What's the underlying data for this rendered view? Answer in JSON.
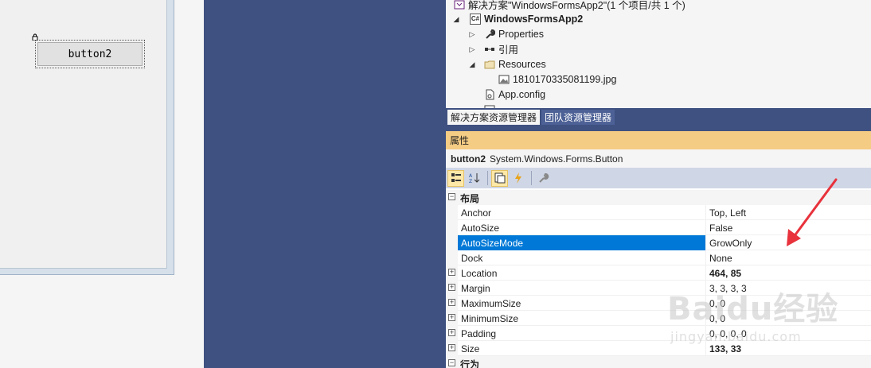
{
  "designer": {
    "button_label": "button2"
  },
  "solution_explorer": {
    "solution_label": "解决方案\"WindowsFormsApp2\"(1 个项目/共 1 个)",
    "project_label": "WindowsFormsApp2",
    "project_badge": "C#",
    "items": [
      {
        "label": "Properties",
        "icon": "wrench-icon"
      },
      {
        "label": "引用",
        "icon": "references-icon"
      },
      {
        "label": "Resources",
        "icon": "folder-icon"
      },
      {
        "label": "1810170335081199.jpg",
        "icon": "image-file-icon"
      },
      {
        "label": "App.config",
        "icon": "config-file-icon"
      }
    ],
    "tabs": [
      "解决方案资源管理器",
      "团队资源管理器"
    ]
  },
  "properties": {
    "title": "属性",
    "object_name": "button2",
    "object_type": "System.Windows.Forms.Button",
    "category_layout": "布局",
    "category_behavior": "行为",
    "rows": [
      {
        "name": "Anchor",
        "value": "Top, Left"
      },
      {
        "name": "AutoSize",
        "value": "False"
      },
      {
        "name": "AutoSizeMode",
        "value": "GrowOnly"
      },
      {
        "name": "Dock",
        "value": "None"
      },
      {
        "name": "Location",
        "value": "464, 85"
      },
      {
        "name": "Margin",
        "value": "3, 3, 3, 3"
      },
      {
        "name": "MaximumSize",
        "value": "0, 0"
      },
      {
        "name": "MinimumSize",
        "value": "0, 0"
      },
      {
        "name": "Padding",
        "value": "0, 0, 0, 0"
      },
      {
        "name": "Size",
        "value": "133, 33"
      }
    ]
  },
  "watermark": {
    "brand": "Baidu经验",
    "url": "jingyan.baidu.com"
  },
  "colors": {
    "accent_selection": "#0078d7",
    "panel_blue": "#3f5181",
    "properties_header": "#f5cc84",
    "annotation_arrow": "#e8323c"
  }
}
